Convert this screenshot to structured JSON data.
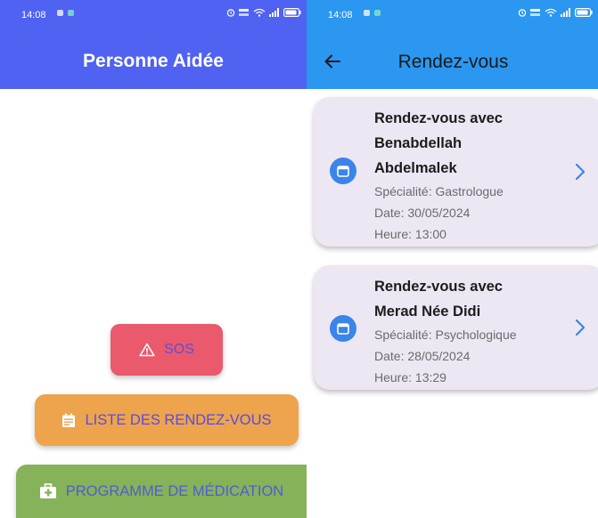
{
  "left_screen": {
    "status_bar": {
      "time": "14:08",
      "icons": [
        "alarm-icon",
        "data-rate-icon",
        "wifi-icon",
        "signal-icon",
        "battery-icon"
      ]
    },
    "app_bar": {
      "title": "Personne Aidée",
      "color": "#4f62f2"
    },
    "buttons": {
      "sos": {
        "label": "SOS",
        "icon": "warning-icon",
        "color": "#ea5a6c"
      },
      "appointments": {
        "label": "LISTE DES RENDEZ-VOUS",
        "icon": "calendar-icon",
        "color": "#eda44c"
      },
      "medication": {
        "label": "PROGRAMME DE MÉDICATION",
        "icon": "medical-kit-icon",
        "color": "#86b259"
      }
    }
  },
  "right_screen": {
    "status_bar": {
      "time": "14:08",
      "icons": [
        "alarm-icon",
        "data-rate-icon",
        "wifi-icon",
        "signal-icon",
        "battery-icon"
      ]
    },
    "app_bar": {
      "title": "Rendez-vous",
      "back_icon": "arrow-left-icon",
      "color": "#2b97f0"
    },
    "appointments": [
      {
        "title_prefix": "Rendez-vous avec",
        "title_name_line1": "Benabdellah",
        "title_name_line2": "Abdelmalek",
        "specialty": "Spécialité: Gastrologue",
        "date": "Date: 30/05/2024",
        "time": "Heure: 13:00",
        "icon": "calendar-icon"
      },
      {
        "title_prefix": "Rendez-vous avec",
        "title_name_line1": "Merad Née Didi",
        "specialty": "Spécialité: Psychologique",
        "date": "Date: 28/05/2024",
        "time": "Heure: 13:29",
        "icon": "calendar-icon"
      }
    ]
  }
}
